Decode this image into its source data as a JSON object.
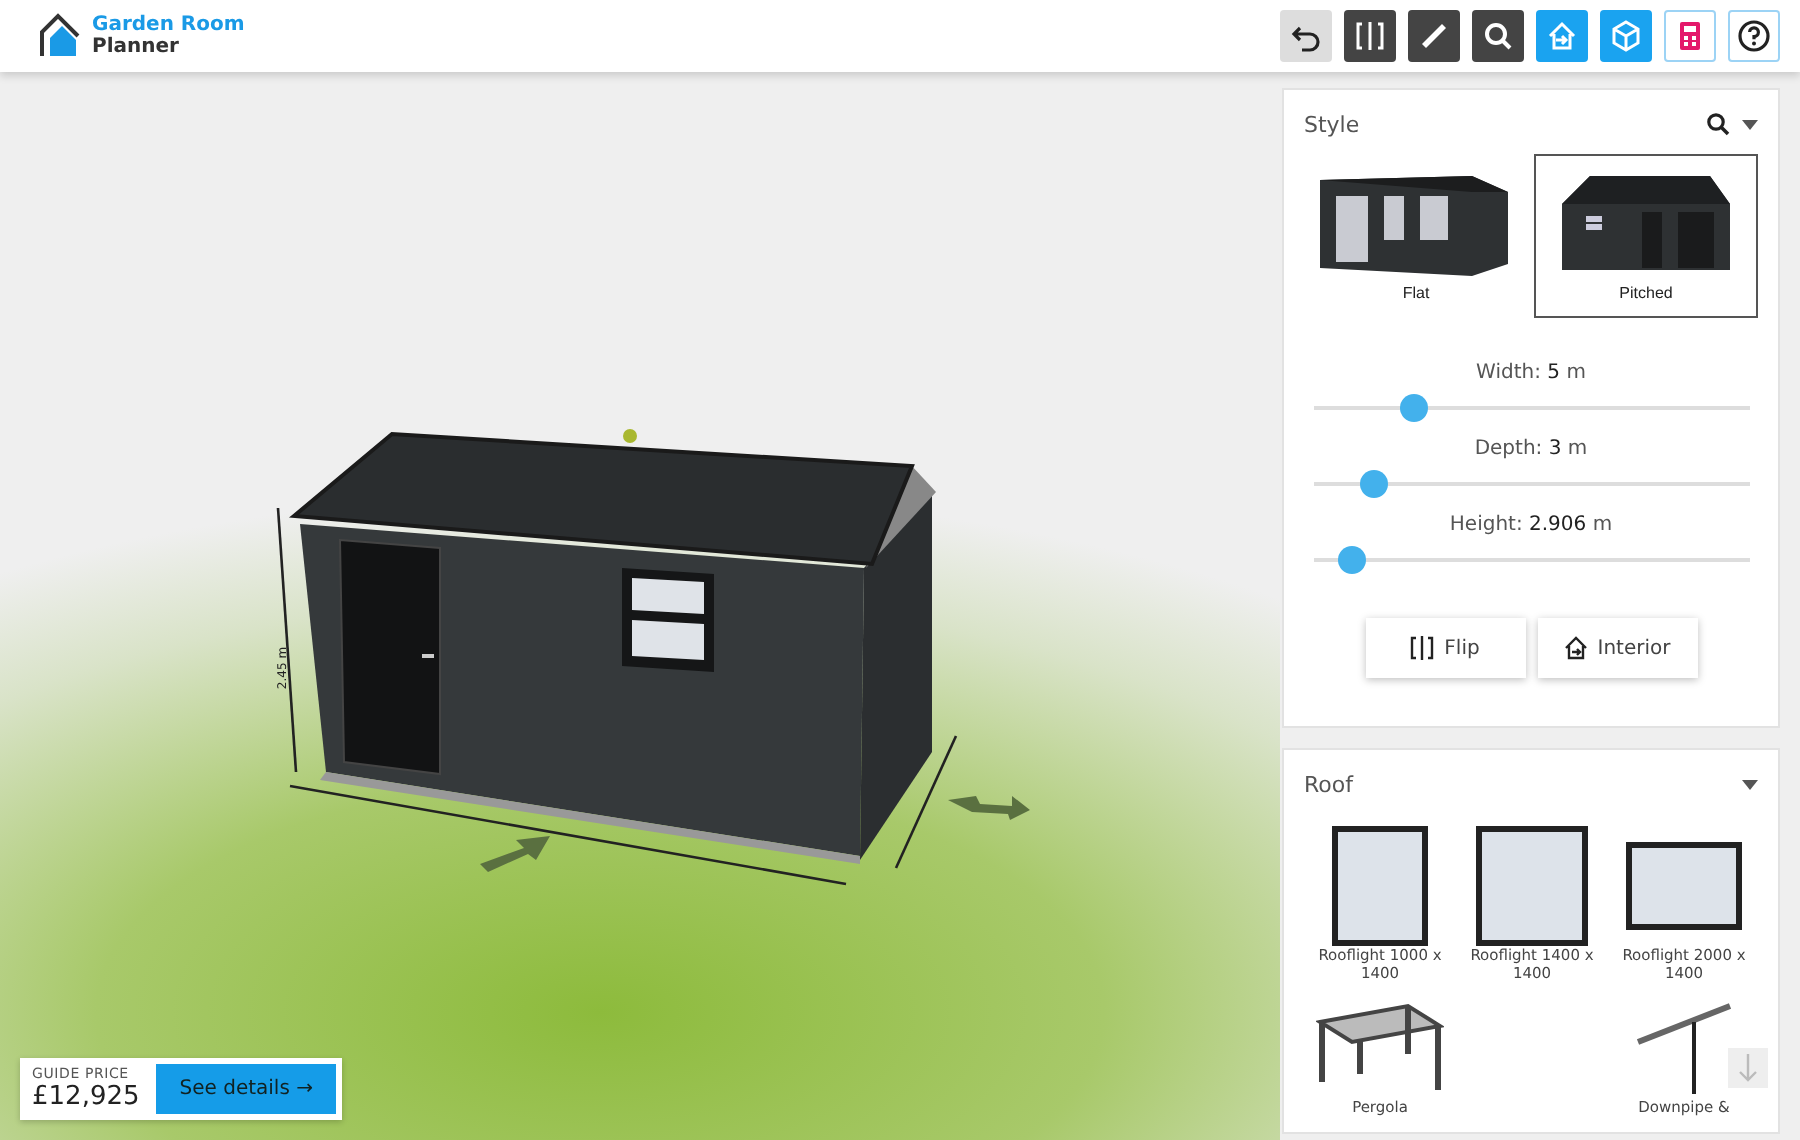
{
  "header": {
    "logo_title": "Garden Room",
    "logo_subtitle": "Planner"
  },
  "toolbar": [
    {
      "kind": "tool",
      "active": false,
      "disabled": true
    },
    {
      "kind": "tool",
      "active": false,
      "disabled": false
    },
    {
      "kind": "tool",
      "active": false,
      "disabled": false
    },
    {
      "kind": "tool",
      "active": false,
      "disabled": false
    },
    {
      "kind": "tool",
      "active": true,
      "disabled": false
    },
    {
      "kind": "tool",
      "active": true,
      "disabled": false
    },
    {
      "kind": "utility"
    },
    {
      "kind": "utility"
    }
  ],
  "viewport": {
    "height_dimension": "2.45 m"
  },
  "price": {
    "label": "GUIDE PRICE",
    "amount": "£12,925",
    "button": "See details →"
  },
  "style_panel": {
    "title": "Style",
    "options": [
      {
        "label": "Flat",
        "selected": false
      },
      {
        "label": "Pitched",
        "selected": true
      }
    ],
    "sliders": [
      {
        "label": "Width:",
        "value": "5",
        "unit": "m",
        "level": 0.23
      },
      {
        "label": "Depth:",
        "value": "3",
        "unit": "m",
        "level": 0.14
      },
      {
        "label": "Height:",
        "value": "2.906",
        "unit": "m",
        "level": 0.09
      }
    ],
    "buttons": [
      {
        "label": "Flip"
      },
      {
        "label": "Interior"
      }
    ]
  },
  "roof_panel": {
    "title": "Roof",
    "items": [
      {
        "kind": "rooflight-portrait",
        "label": "Rooflight 1000 x 1400"
      },
      {
        "kind": "rooflight-square",
        "label": "Rooflight 1400 x 1400"
      },
      {
        "kind": "rooflight-landscape",
        "label": "Rooflight 2000 x 1400"
      },
      {
        "kind": "pergola",
        "label": "Pergola"
      },
      {
        "kind": "empty"
      },
      {
        "kind": "downpipe",
        "label": "Downpipe &"
      }
    ]
  }
}
